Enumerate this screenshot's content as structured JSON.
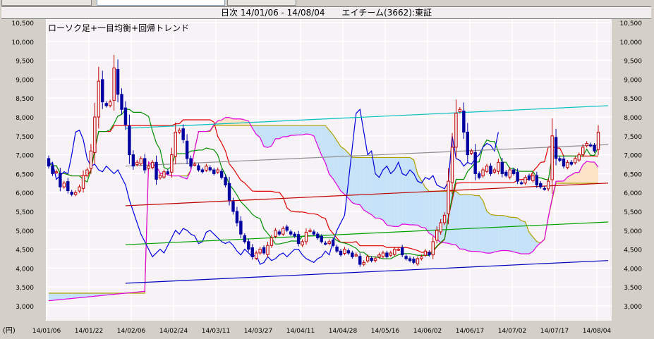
{
  "header": {
    "period": "日次 14/01/06 - 14/08/04",
    "symbol": "エイチーム(3662):東証"
  },
  "chart_data": {
    "type": "candlestick",
    "title": "ローソク足+一目均衡+回帰トレンド",
    "unit_label": "(円)",
    "ylim": [
      2700,
      10600
    ],
    "yticks": [
      3000,
      3500,
      4000,
      4500,
      5000,
      5500,
      6000,
      6500,
      7000,
      7500,
      8000,
      8500,
      9000,
      9500,
      10000,
      10500
    ],
    "ytick_labels": [
      "3,000",
      "3,500",
      "4,000",
      "4,500",
      "5,000",
      "5,500",
      "6,000",
      "6,500",
      "7,000",
      "7,500",
      "8,000",
      "8,500",
      "9,000",
      "9,500",
      "10,000",
      "10,500"
    ],
    "xtick_labels": [
      "14/01/06",
      "14/01/22",
      "14/02/06",
      "14/02/24",
      "14/03/11",
      "14/03/27",
      "14/04/11",
      "14/04/28",
      "14/05/16",
      "14/06/02",
      "14/06/17",
      "14/07/02",
      "14/07/17",
      "14/08/04"
    ],
    "close": [
      6700,
      6500,
      6550,
      6150,
      6250,
      6050,
      5950,
      6000,
      6150,
      6450,
      6600,
      7100,
      8000,
      8950,
      8400,
      8300,
      8400,
      9300,
      8600,
      8200,
      7800,
      7000,
      6700,
      6800,
      6900,
      6600,
      6700,
      6800,
      6350,
      6450,
      6550,
      6500,
      7000,
      7600,
      7650,
      7400,
      6900,
      6700,
      6750,
      6600,
      6550,
      6700,
      6600,
      6500,
      6600,
      6400,
      6200,
      5800,
      5500,
      5200,
      4900,
      4700,
      4500,
      4300,
      4400,
      4500,
      4400,
      4600,
      4800,
      5000,
      4900,
      5050,
      5000,
      4900,
      4850,
      4650,
      4700,
      4950,
      5000,
      4900,
      4800,
      4700,
      4650,
      4700,
      4600,
      4450,
      4350,
      4500,
      4400,
      4300,
      4350,
      4100,
      4150,
      4300,
      4200,
      4250,
      4350,
      4400,
      4300,
      4400,
      4500,
      4500,
      4350,
      4250,
      4200,
      4150,
      4250,
      4300,
      4450,
      4350,
      4700,
      5000,
      5200,
      5400,
      6300,
      7200,
      8100,
      8200,
      7600,
      7000,
      7100,
      6500,
      6400,
      6600,
      6700,
      6500,
      6600,
      6800,
      6500,
      6450,
      6600,
      6500,
      6300,
      6250,
      6400,
      6350,
      6450,
      6200,
      6150,
      6100,
      6300,
      7500,
      6900,
      6850,
      6700,
      6800,
      6750,
      6900,
      7000,
      7200,
      7300,
      7250,
      7100,
      7600
    ],
    "ichimoku": {
      "tenkan": 9,
      "kijun": 26,
      "senkou_b": 52,
      "shift": 26
    },
    "trend_lines": [
      {
        "name": "upper2",
        "color": "#00c0c0",
        "start": 7700,
        "end": 8300
      },
      {
        "name": "upper1",
        "color": "#909090",
        "start": 6700,
        "end": 7270
      },
      {
        "name": "center",
        "color": "#c00000",
        "start": 5650,
        "end": 6250
      },
      {
        "name": "lower1",
        "color": "#00a000",
        "start": 4620,
        "end": 5220
      },
      {
        "name": "lower2",
        "color": "#0000c0",
        "start": 3600,
        "end": 4200
      }
    ],
    "trend_start_index": 20,
    "colors": {
      "up": "#c00000",
      "down": "#0000a0",
      "tenkan": "#009000",
      "kijun": "#e00000",
      "spanA": "#e000e0",
      "spanB": "#b0a000",
      "chikou": "#0000e0",
      "cloud_up": "#fde3c6",
      "cloud_down": "#c6e2f8"
    }
  }
}
